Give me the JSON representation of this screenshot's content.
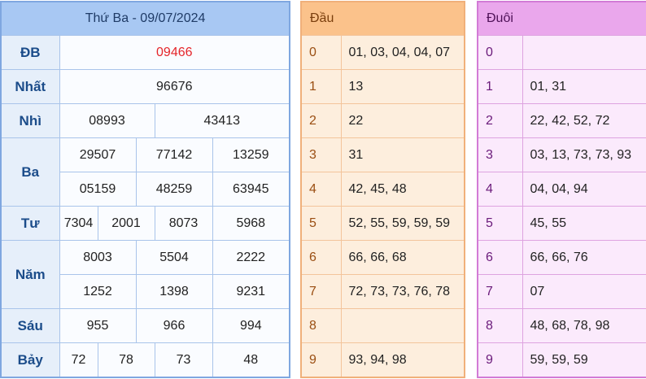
{
  "results": {
    "title": "Thứ Ba - 09/07/2024",
    "special_color": "#e5252a",
    "prizes": [
      {
        "label": "ĐB",
        "values": [
          "09466"
        ]
      },
      {
        "label": "Nhất",
        "values": [
          "96676"
        ]
      },
      {
        "label": "Nhì",
        "values": [
          "08993",
          "43413"
        ]
      },
      {
        "label": "Ba",
        "values": [
          "29507",
          "77142",
          "13259",
          "05159",
          "48259",
          "63945"
        ]
      },
      {
        "label": "Tư",
        "values": [
          "7304",
          "2001",
          "8073",
          "5968"
        ]
      },
      {
        "label": "Năm",
        "values": [
          "8003",
          "5504",
          "2222",
          "1252",
          "1398",
          "9231"
        ]
      },
      {
        "label": "Sáu",
        "values": [
          "955",
          "966",
          "994"
        ]
      },
      {
        "label": "Bảy",
        "values": [
          "72",
          "78",
          "73",
          "48"
        ]
      }
    ]
  },
  "heads": {
    "header": "Đầu",
    "rows": [
      {
        "digit": "0",
        "nums": "01, 03, 04, 04, 07"
      },
      {
        "digit": "1",
        "nums": "13"
      },
      {
        "digit": "2",
        "nums": "22"
      },
      {
        "digit": "3",
        "nums": "31"
      },
      {
        "digit": "4",
        "nums": "42, 45, 48"
      },
      {
        "digit": "5",
        "nums": "52, 55, 59, 59, 59"
      },
      {
        "digit": "6",
        "nums": "66, 66, 68"
      },
      {
        "digit": "7",
        "nums": "72, 73, 73, 76, 78"
      },
      {
        "digit": "8",
        "nums": ""
      },
      {
        "digit": "9",
        "nums": "93, 94, 98"
      }
    ]
  },
  "tails": {
    "header": "Đuôi",
    "rows": [
      {
        "digit": "0",
        "nums": ""
      },
      {
        "digit": "1",
        "nums": "01, 31"
      },
      {
        "digit": "2",
        "nums": "22, 42, 52, 72"
      },
      {
        "digit": "3",
        "nums": "03, 13, 73, 73, 93"
      },
      {
        "digit": "4",
        "nums": "04, 04, 94"
      },
      {
        "digit": "5",
        "nums": "45, 55"
      },
      {
        "digit": "6",
        "nums": "66, 66, 76"
      },
      {
        "digit": "7",
        "nums": "07"
      },
      {
        "digit": "8",
        "nums": "48, 68, 78, 98"
      },
      {
        "digit": "9",
        "nums": "59, 59, 59"
      }
    ]
  }
}
